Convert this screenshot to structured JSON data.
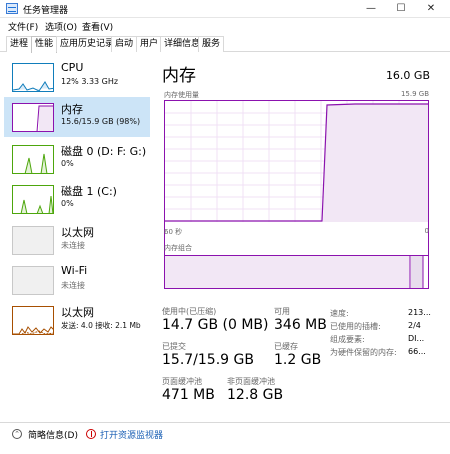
{
  "window": {
    "title": "任务管理器"
  },
  "menu": [
    "文件(F)",
    "选项(O)",
    "查看(V)"
  ],
  "tabs": [
    "进程",
    "性能",
    "应用历史记录",
    "启动",
    "用户",
    "详细信息",
    "服务"
  ],
  "active_tab": "性能",
  "sidebar": {
    "items": [
      {
        "name": "CPU",
        "sub": "12%  3.33 GHz",
        "color": "#117dbb"
      },
      {
        "name": "内存",
        "sub": "15.6/15.9 GB (98%)",
        "color": "#8b12ae"
      },
      {
        "name": "磁盘 0 (D: F: G:)",
        "sub": "0%",
        "color": "#4da60c"
      },
      {
        "name": "磁盘 1 (C:)",
        "sub": "0%",
        "color": "#4da60c"
      },
      {
        "name": "以太网",
        "sub": "未连接",
        "color": "#a74f01"
      },
      {
        "name": "Wi-Fi",
        "sub": "未连接",
        "color": "#a74f01"
      },
      {
        "name": "以太网",
        "sub": "发送: 4.0  接收: 2.1 Mb",
        "color": "#a74f01"
      }
    ]
  },
  "main": {
    "title": "内存",
    "total": "16.0 GB",
    "usage_label": "内存使用量",
    "usage_max": "15.9 GB",
    "time_left": "60 秒",
    "time_right": "0",
    "composition_label": "内存组合",
    "accent": "#8b12ae",
    "in_use_fraction": 0.98
  },
  "stats": {
    "in_use_label": "使用中(已压缩)",
    "in_use_value": "14.7 GB (0 MB)",
    "available_label": "可用",
    "available_value": "346 MB",
    "committed_label": "已提交",
    "committed_value": "15.7/15.9 GB",
    "cached_label": "已缓存",
    "cached_value": "1.2 GB",
    "paged_label": "页面缓冲池",
    "paged_value": "471 MB",
    "nonpaged_label": "非页面缓冲池",
    "nonpaged_value": "12.8 GB"
  },
  "details": [
    {
      "label": "速度:",
      "value": "213..."
    },
    {
      "label": "已使用的插槽:",
      "value": "2/4"
    },
    {
      "label": "组成要素:",
      "value": "DI..."
    },
    {
      "label": "为硬件保留的内存:",
      "value": "66..."
    }
  ],
  "footer": {
    "fewer_details": "简略信息(D)",
    "resource_monitor": "打开资源监视器"
  }
}
